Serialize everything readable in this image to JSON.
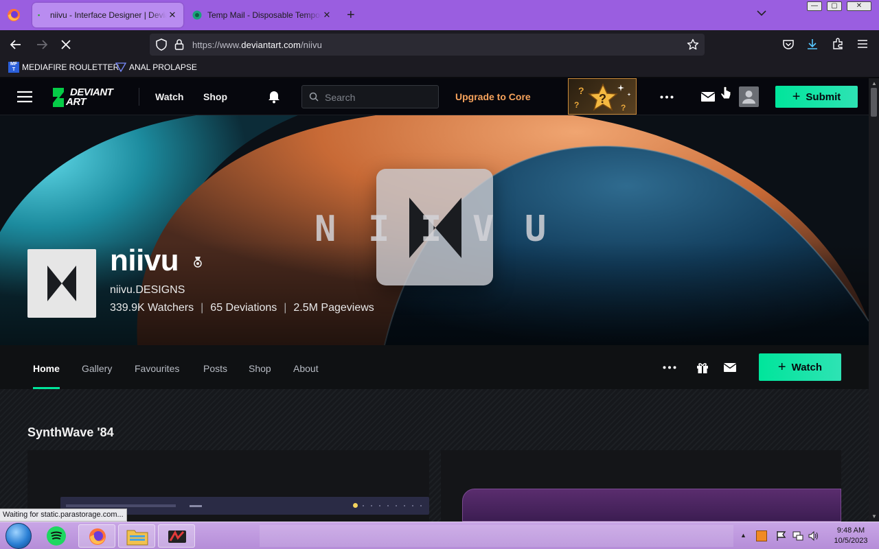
{
  "browser": {
    "tabs": [
      {
        "title": "niivu - Interface Designer | DeviantArt",
        "active": true
      },
      {
        "title": "Temp Mail - Disposable Temporary Email",
        "active": false
      }
    ],
    "url_prefix": "https://www.",
    "url_domain": "deviantart.com",
    "url_path": "/niivu",
    "bookmarks": [
      {
        "label": "MEDIAFIRE ROULETTER",
        "icon": "mediafire-icon"
      },
      {
        "label": "ANAL PROLAPSE",
        "icon": "folder-bookmark-icon"
      }
    ],
    "status_text": "Waiting for static.parastorage.com..."
  },
  "da_header": {
    "logo_text_top": "DEVIANT",
    "logo_text_bottom": "ART",
    "nav": [
      "Watch",
      "Shop"
    ],
    "search_placeholder": "Search",
    "upgrade_label": "Upgrade to Core",
    "submit_label": "Submit"
  },
  "profile": {
    "banner_letters": [
      "N",
      "I",
      "I",
      "V",
      "U"
    ],
    "username": "niivu",
    "tagline": "niivu.DESIGNS",
    "stats": {
      "watchers": "339.9K Watchers",
      "deviations": "65 Deviations",
      "pageviews": "2.5M Pageviews"
    },
    "tabs": [
      "Home",
      "Gallery",
      "Favourites",
      "Posts",
      "Shop",
      "About"
    ],
    "active_tab": "Home",
    "watch_label": "Watch"
  },
  "content": {
    "section_title": "SynthWave '84"
  },
  "taskbar": {
    "time": "9:48 AM",
    "date": "10/5/2023"
  },
  "colors": {
    "accent_green": "#00e59b",
    "upgrade_orange": "#f7a35c",
    "firefox_purple": "#9a5ee0"
  }
}
